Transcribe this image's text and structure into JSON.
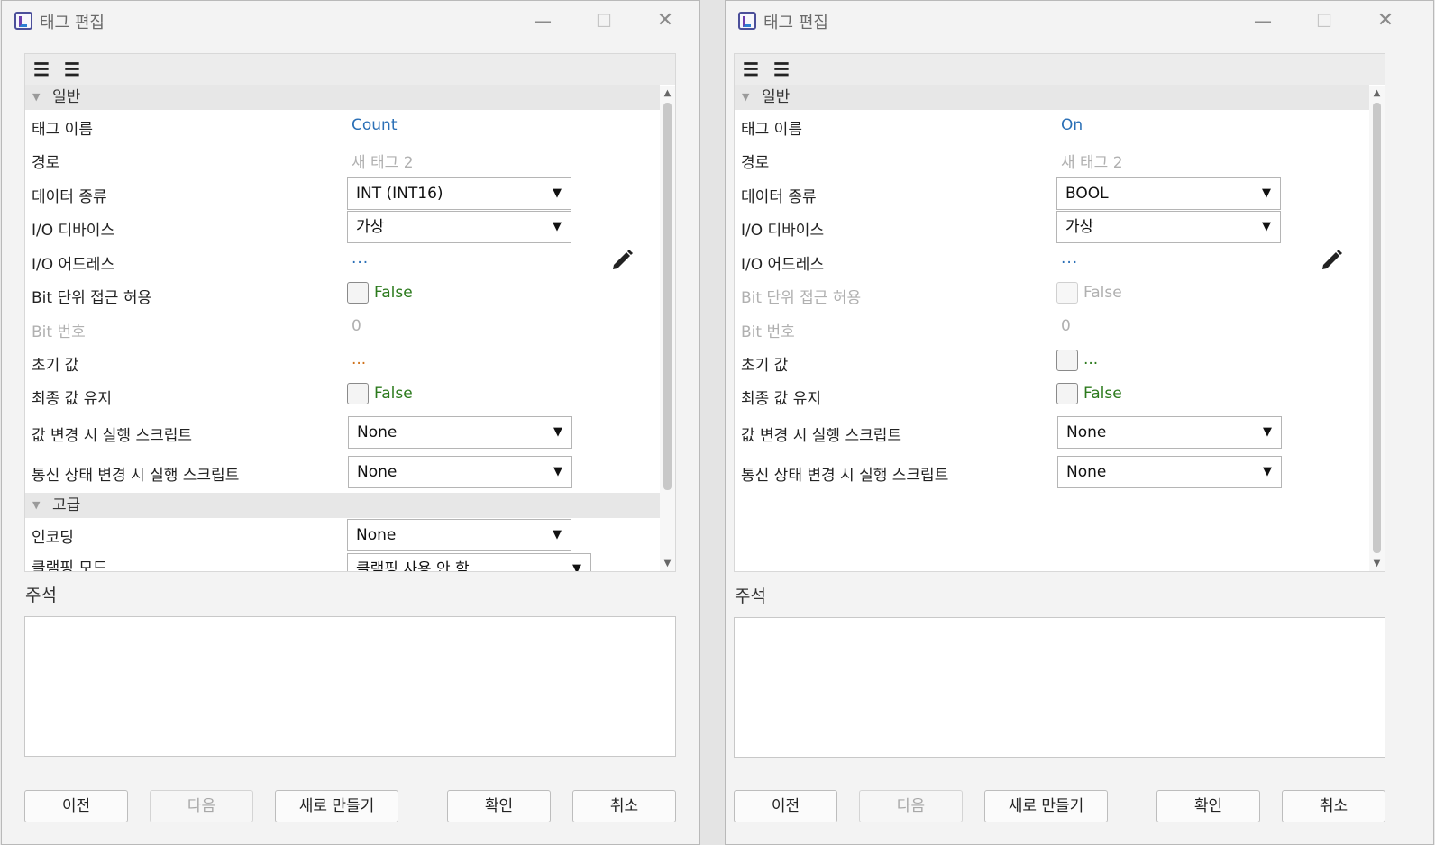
{
  "windows": [
    {
      "title": "태그 편집",
      "section_general": "일반",
      "section_advanced": "고급",
      "labels": {
        "tag_name": "태그 이름",
        "path": "경로",
        "data_type": "데이터 종류",
        "io_device": "I/O 디바이스",
        "io_address": "I/O 어드레스",
        "bit_access": "Bit 단위 접근 허용",
        "bit_number": "Bit 번호",
        "initial_value": "초기 값",
        "retain_last": "최종 값 유지",
        "on_change_script": "값 변경 시 실행 스크립트",
        "comm_change_script": "통신 상태 변경 시 실행 스크립트",
        "encoding": "인코딩",
        "clamp_mode": "클램핑 모드"
      },
      "values": {
        "tag_name": "Count",
        "path": "새 태그 2",
        "data_type": "INT (INT16)",
        "io_device": "가상",
        "io_address": "...",
        "bit_access": "False",
        "bit_number": "0",
        "initial_value": "...",
        "retain_last": "False",
        "on_change_script": "None",
        "comm_change_script": "None",
        "encoding": "None",
        "clamp_mode": "클램핑 사용 안 함"
      },
      "comment_label": "주석",
      "buttons": {
        "prev": "이전",
        "next": "다음",
        "new": "새로 만들기",
        "ok": "확인",
        "cancel": "취소"
      }
    },
    {
      "title": "태그 편집",
      "section_general": "일반",
      "labels": {
        "tag_name": "태그 이름",
        "path": "경로",
        "data_type": "데이터 종류",
        "io_device": "I/O 디바이스",
        "io_address": "I/O 어드레스",
        "bit_access": "Bit 단위 접근 허용",
        "bit_number": "Bit 번호",
        "initial_value": "초기 값",
        "retain_last": "최종 값 유지",
        "on_change_script": "값 변경 시 실행 스크립트",
        "comm_change_script": "통신 상태 변경 시 실행 스크립트"
      },
      "values": {
        "tag_name": "On",
        "path": "새 태그 2",
        "data_type": "BOOL",
        "io_device": "가상",
        "io_address": "...",
        "bit_access": "False",
        "bit_number": "0",
        "initial_value": "...",
        "retain_last": "False",
        "on_change_script": "None",
        "comm_change_script": "None"
      },
      "comment_label": "주석",
      "buttons": {
        "prev": "이전",
        "next": "다음",
        "new": "새로 만들기",
        "ok": "확인",
        "cancel": "취소"
      }
    }
  ],
  "icons": {
    "sort_categorized": "sort-categorized-icon",
    "sort_alpha": "sort-alphabetical-icon",
    "edit": "pencil-icon"
  },
  "colors": {
    "value_blue": "#2a6fb6",
    "value_green": "#2c7a1d",
    "value_orange": "#d0721b",
    "disabled_gray": "#b0b0b0"
  }
}
